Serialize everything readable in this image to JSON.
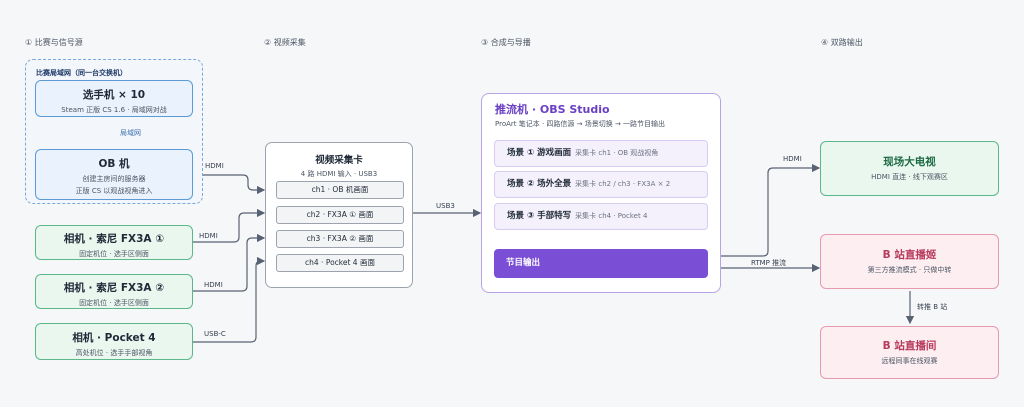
{
  "columns": [
    "① 比赛与信号源",
    "② 视频采集",
    "③ 合成与导播",
    "④ 双路输出"
  ],
  "lan": {
    "title": "比赛局域网（同一台交换机）",
    "player": {
      "title": "选手机 × 10",
      "sub": "Steam 正版 CS 1.6 · 局域网对战"
    },
    "lan_edge": "局域网",
    "ob": {
      "title": "OB 机",
      "sub1": "创建主房间的服务器",
      "sub2": "正版 CS 以观战视角进入"
    }
  },
  "cameras": [
    {
      "title": "相机 · 索尼 FX3A ①",
      "sub": "固定机位 · 选手区侧面",
      "edge": "HDMI"
    },
    {
      "title": "相机 · 索尼 FX3A ②",
      "sub": "固定机位 · 选手区侧面",
      "edge": "HDMI"
    },
    {
      "title": "相机 · Pocket 4",
      "sub": "高处机位 · 选手手部视角",
      "edge": "USB-C"
    }
  ],
  "ob_edge": "HDMI",
  "capture": {
    "title": "视频采集卡",
    "sub": "4 路 HDMI 输入 · USB3",
    "channels": [
      "ch1 · OB 机画面",
      "ch2 · FX3A ① 画面",
      "ch3 · FX3A ② 画面",
      "ch4 · Pocket 4 画面"
    ],
    "edge": "USB3"
  },
  "obs": {
    "title": "推流机 · OBS Studio",
    "sub": "ProArt 笔记本 · 四路信源 → 场景切换 → 一路节目输出",
    "scenes": [
      {
        "name": "场景 ① 游戏画面",
        "sub": "采集卡 ch1 · OB 观战视角"
      },
      {
        "name": "场景 ② 场外全景",
        "sub": "采集卡 ch2 / ch3 · FX3A × 2"
      },
      {
        "name": "场景 ③ 手部特写",
        "sub": "采集卡 ch4 · Pocket 4"
      }
    ],
    "program": "节目输出"
  },
  "outputs": {
    "tv": {
      "title": "现场大电视",
      "sub": "HDMI 直连 · 线下观赛区",
      "edge": "HDMI"
    },
    "bili_ji": {
      "title": "B 站直播姬",
      "sub": "第三方推流模式 · 只做中转",
      "edge": "RTMP 推流"
    },
    "bili_room": {
      "title": "B 站直播间",
      "sub": "远程同事在线观赛",
      "edge": "转推 B 站"
    }
  },
  "colors": {
    "blue": "#5b9bd5",
    "green": "#5cb88a",
    "pink": "#e79aad",
    "purple": "#7a4fd6",
    "arrow": "#596273"
  }
}
